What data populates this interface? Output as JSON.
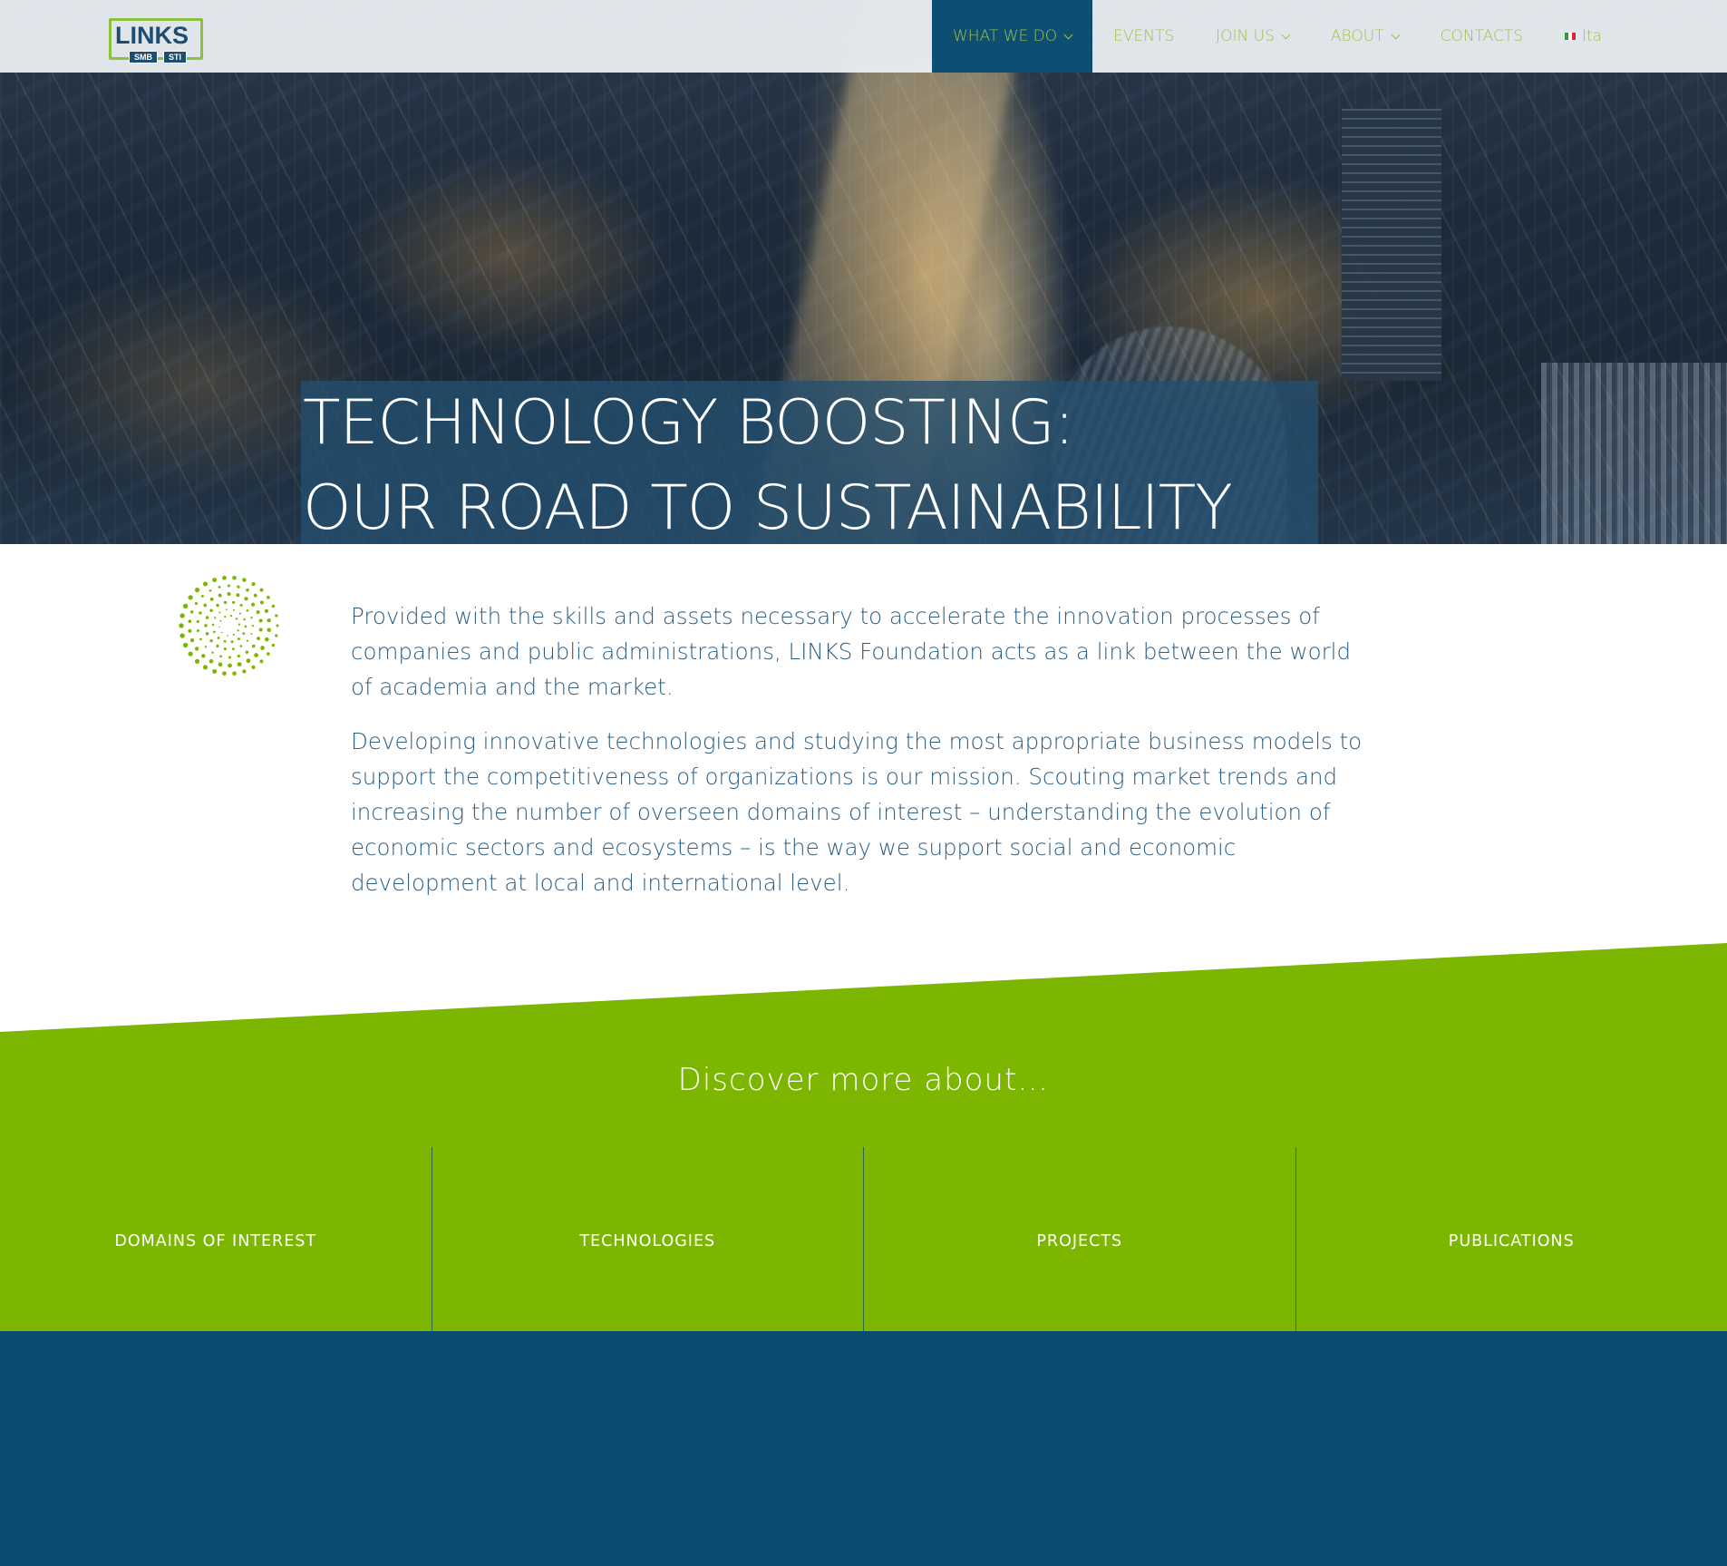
{
  "header": {
    "logo": {
      "wordmark": "LINKS",
      "sub_left": "SMB",
      "sub_right": "STI"
    },
    "nav": [
      {
        "label": "WHAT WE DO",
        "has_dropdown": true,
        "active": true
      },
      {
        "label": "EVENTS",
        "has_dropdown": false,
        "active": false
      },
      {
        "label": "JOIN US",
        "has_dropdown": true,
        "active": false
      },
      {
        "label": "ABOUT",
        "has_dropdown": true,
        "active": false
      },
      {
        "label": "CONTACTS",
        "has_dropdown": false,
        "active": false
      }
    ],
    "language": {
      "label": "Ita",
      "flag_icon": "italy-flag-icon"
    }
  },
  "hero": {
    "title_line1": "TECHNOLOGY BOOSTING:",
    "title_line2": "OUR ROAD TO SUSTAINABILITY"
  },
  "intro": {
    "icon": "dotted-spiral-icon",
    "paragraphs": [
      "Provided with the skills and assets necessary to accelerate the innovation processes of companies and public administrations, LINKS Foundation acts as a link between the world of academia and the market.",
      "Developing innovative technologies and studying the most appropriate business models to support the competitiveness of organizations is our mission. Scouting market trends and increasing the number of overseen domains of interest – understanding the evolution of economic sectors and ecosystems – is the way we support social and economic development at local and international level."
    ]
  },
  "discover": {
    "heading": "Discover more about…",
    "tiles": [
      {
        "label": "DOMAINS OF INTEREST"
      },
      {
        "label": "TECHNOLOGIES"
      },
      {
        "label": "PROJECTS"
      },
      {
        "label": "PUBLICATIONS"
      }
    ]
  },
  "colors": {
    "brand_green": "#7db600",
    "nav_green": "#9cc24f",
    "brand_blue": "#0b4d71",
    "text_blue": "#2b5f86",
    "header_bg": "#eceff3"
  }
}
